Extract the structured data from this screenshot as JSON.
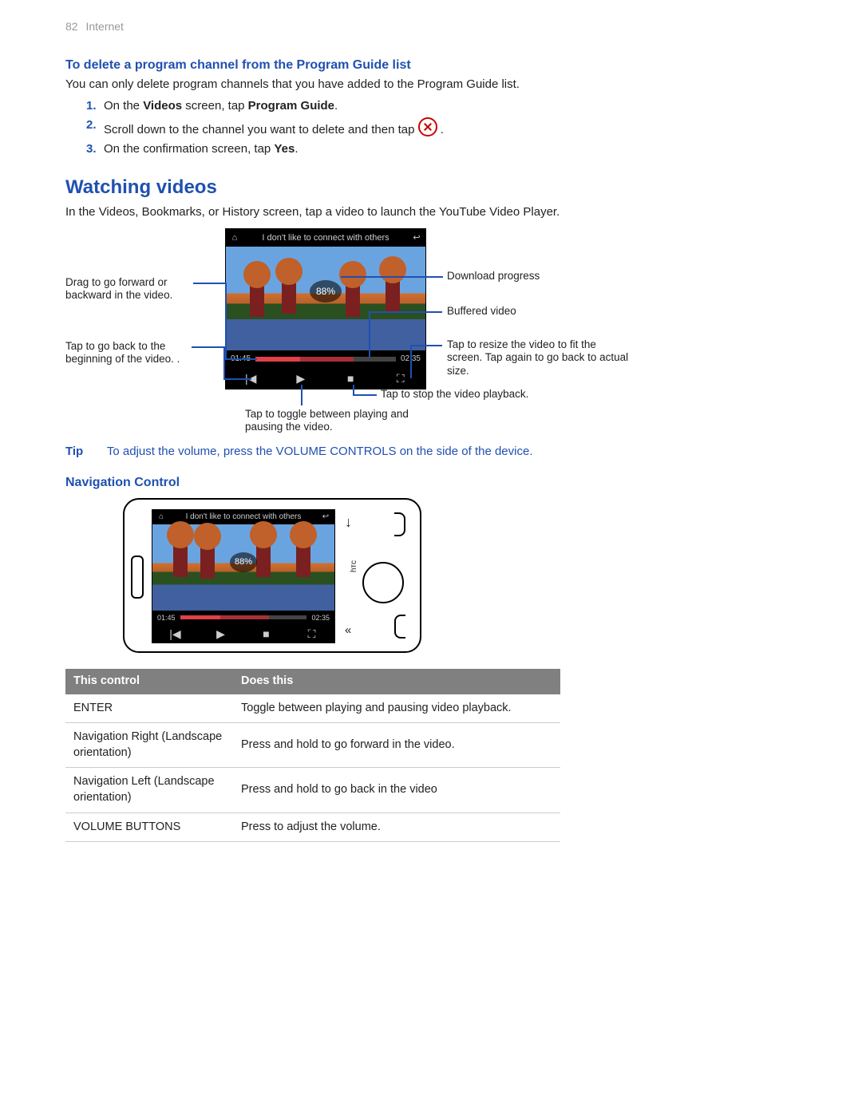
{
  "header": {
    "page_num": "82",
    "section": "Internet"
  },
  "section1": {
    "title": "To delete a program channel from the Program Guide list",
    "intro": "You can only delete program channels that you have added to the Program Guide list.",
    "steps": {
      "s1_pre": "On the ",
      "s1_b1": "Videos",
      "s1_mid": " screen, tap ",
      "s1_b2": "Program Guide",
      "s1_post": ".",
      "s2_pre": "Scroll down to the channel you want to delete and then tap ",
      "s2_post": " .",
      "s3_pre": "On the confirmation screen, tap ",
      "s3_b1": "Yes",
      "s3_post": "."
    }
  },
  "section2": {
    "title": "Watching videos",
    "intro": "In the Videos, Bookmarks, or History screen, tap a video to launch the YouTube Video Player."
  },
  "player": {
    "title": "I don't like to connect with others",
    "percent": "88%",
    "t_cur": "01:45",
    "t_tot": "02:35",
    "buffer_pct": "70%",
    "play_pct": "32%"
  },
  "callouts": {
    "drag": "Drag to go forward or backward in the video.",
    "rewind": "Tap to go back to the beginning of the video. .",
    "download": "Download progress",
    "buffered": "Buffered video",
    "resize": "Tap to resize the video to fit the screen. Tap again to go back to actual size.",
    "stop": "Tap to stop the video playback.",
    "toggle": "Tap to toggle between playing and pausing the video."
  },
  "tip": {
    "label": "Tip",
    "text": "To adjust the volume, press the VOLUME CONTROLS on the side of the device."
  },
  "section3": {
    "title": "Navigation Control"
  },
  "table": {
    "h1": "This control",
    "h2": "Does this",
    "r1c1": "ENTER",
    "r1c2": "Toggle between playing and pausing video playback.",
    "r2c1": "Navigation Right (Landscape orientation)",
    "r2c2": "Press and hold to go forward in the video.",
    "r3c1": "Navigation Left (Landscape orientation)",
    "r3c2": "Press and hold to go back in the video",
    "r4c1": "VOLUME BUTTONS",
    "r4c2": "Press to adjust the volume."
  },
  "glyphs": {
    "home": "⌂",
    "reply": "↩",
    "prev": "|◀",
    "play": "▶",
    "stop": "■",
    "full": "⛶",
    "down": "↓",
    "dbl": "«",
    "htc": "hтc"
  }
}
